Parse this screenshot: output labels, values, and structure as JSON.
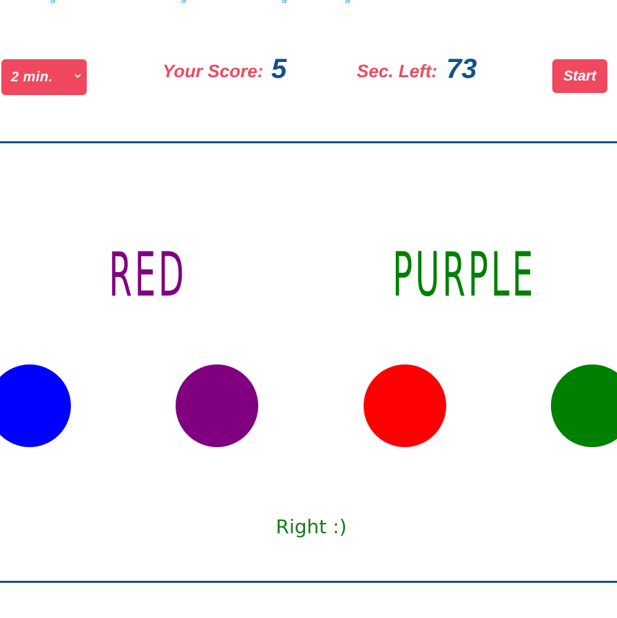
{
  "controls": {
    "duration_value": "2 min.",
    "score_label": "Your Score:",
    "score_value": "5",
    "time_label": "Sec. Left:",
    "time_value": "73",
    "start_label": "Start"
  },
  "game": {
    "words": [
      {
        "text": "RED",
        "ink_color": "#800080"
      },
      {
        "text": "PURPLE",
        "ink_color": "#008000"
      }
    ],
    "choices": [
      {
        "color": "#0000ff"
      },
      {
        "color": "#800080"
      },
      {
        "color": "#ff0000"
      },
      {
        "color": "#008000"
      }
    ],
    "feedback": "Right :)",
    "feedback_color": "#1a7a1a"
  },
  "theme": {
    "accent": "#f0495f",
    "number_color": "#11508f",
    "divider_color": "#11508f",
    "link_color": "#1a9fd6"
  }
}
